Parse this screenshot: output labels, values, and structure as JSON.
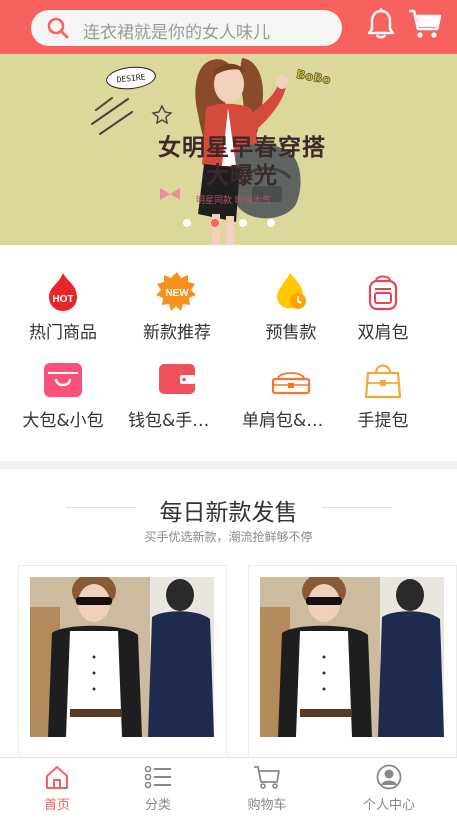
{
  "header": {
    "search_placeholder": "连衣裙就是你的女人味儿",
    "search_icon": "search-icon",
    "bell_icon": "bell-icon",
    "cart_icon": "cart-icon",
    "accent": "#f7615e"
  },
  "banner": {
    "title_line1": "女明星早春穿搭",
    "title_line2": "大曝光",
    "subtitle": "明星同款 时尚大气",
    "badge_desire": "DESIRE",
    "badge_bobo": "BoBo",
    "slide_count": 4,
    "active_slide": 2,
    "background": "#dcd79a"
  },
  "categories": [
    {
      "label": "热门商品",
      "icon": "hot-icon"
    },
    {
      "label": "新款推荐",
      "icon": "new-icon"
    },
    {
      "label": "预售款",
      "icon": "presale-icon"
    },
    {
      "label": "双肩包",
      "icon": "backpack-icon"
    },
    {
      "label": "大包&小包",
      "icon": "tote-bag-icon"
    },
    {
      "label": "钱包&手拿包",
      "icon": "wallet-icon"
    },
    {
      "label": "单肩包&斜挎包",
      "icon": "shoulder-bag-icon"
    },
    {
      "label": "手提包",
      "icon": "handbag-icon"
    }
  ],
  "daily": {
    "title": "每日新款发售",
    "subtitle": "买手优选新款，潮流抢鲜够不停",
    "products": [
      {
        "image": "product-photo-shirt"
      },
      {
        "image": "product-photo-shirt"
      }
    ]
  },
  "tabbar": [
    {
      "label": "首页",
      "icon": "home-icon",
      "active": true
    },
    {
      "label": "分类",
      "icon": "list-icon",
      "active": false
    },
    {
      "label": "购物车",
      "icon": "cart-icon",
      "active": false
    },
    {
      "label": "个人中心",
      "icon": "user-icon",
      "active": false
    }
  ]
}
